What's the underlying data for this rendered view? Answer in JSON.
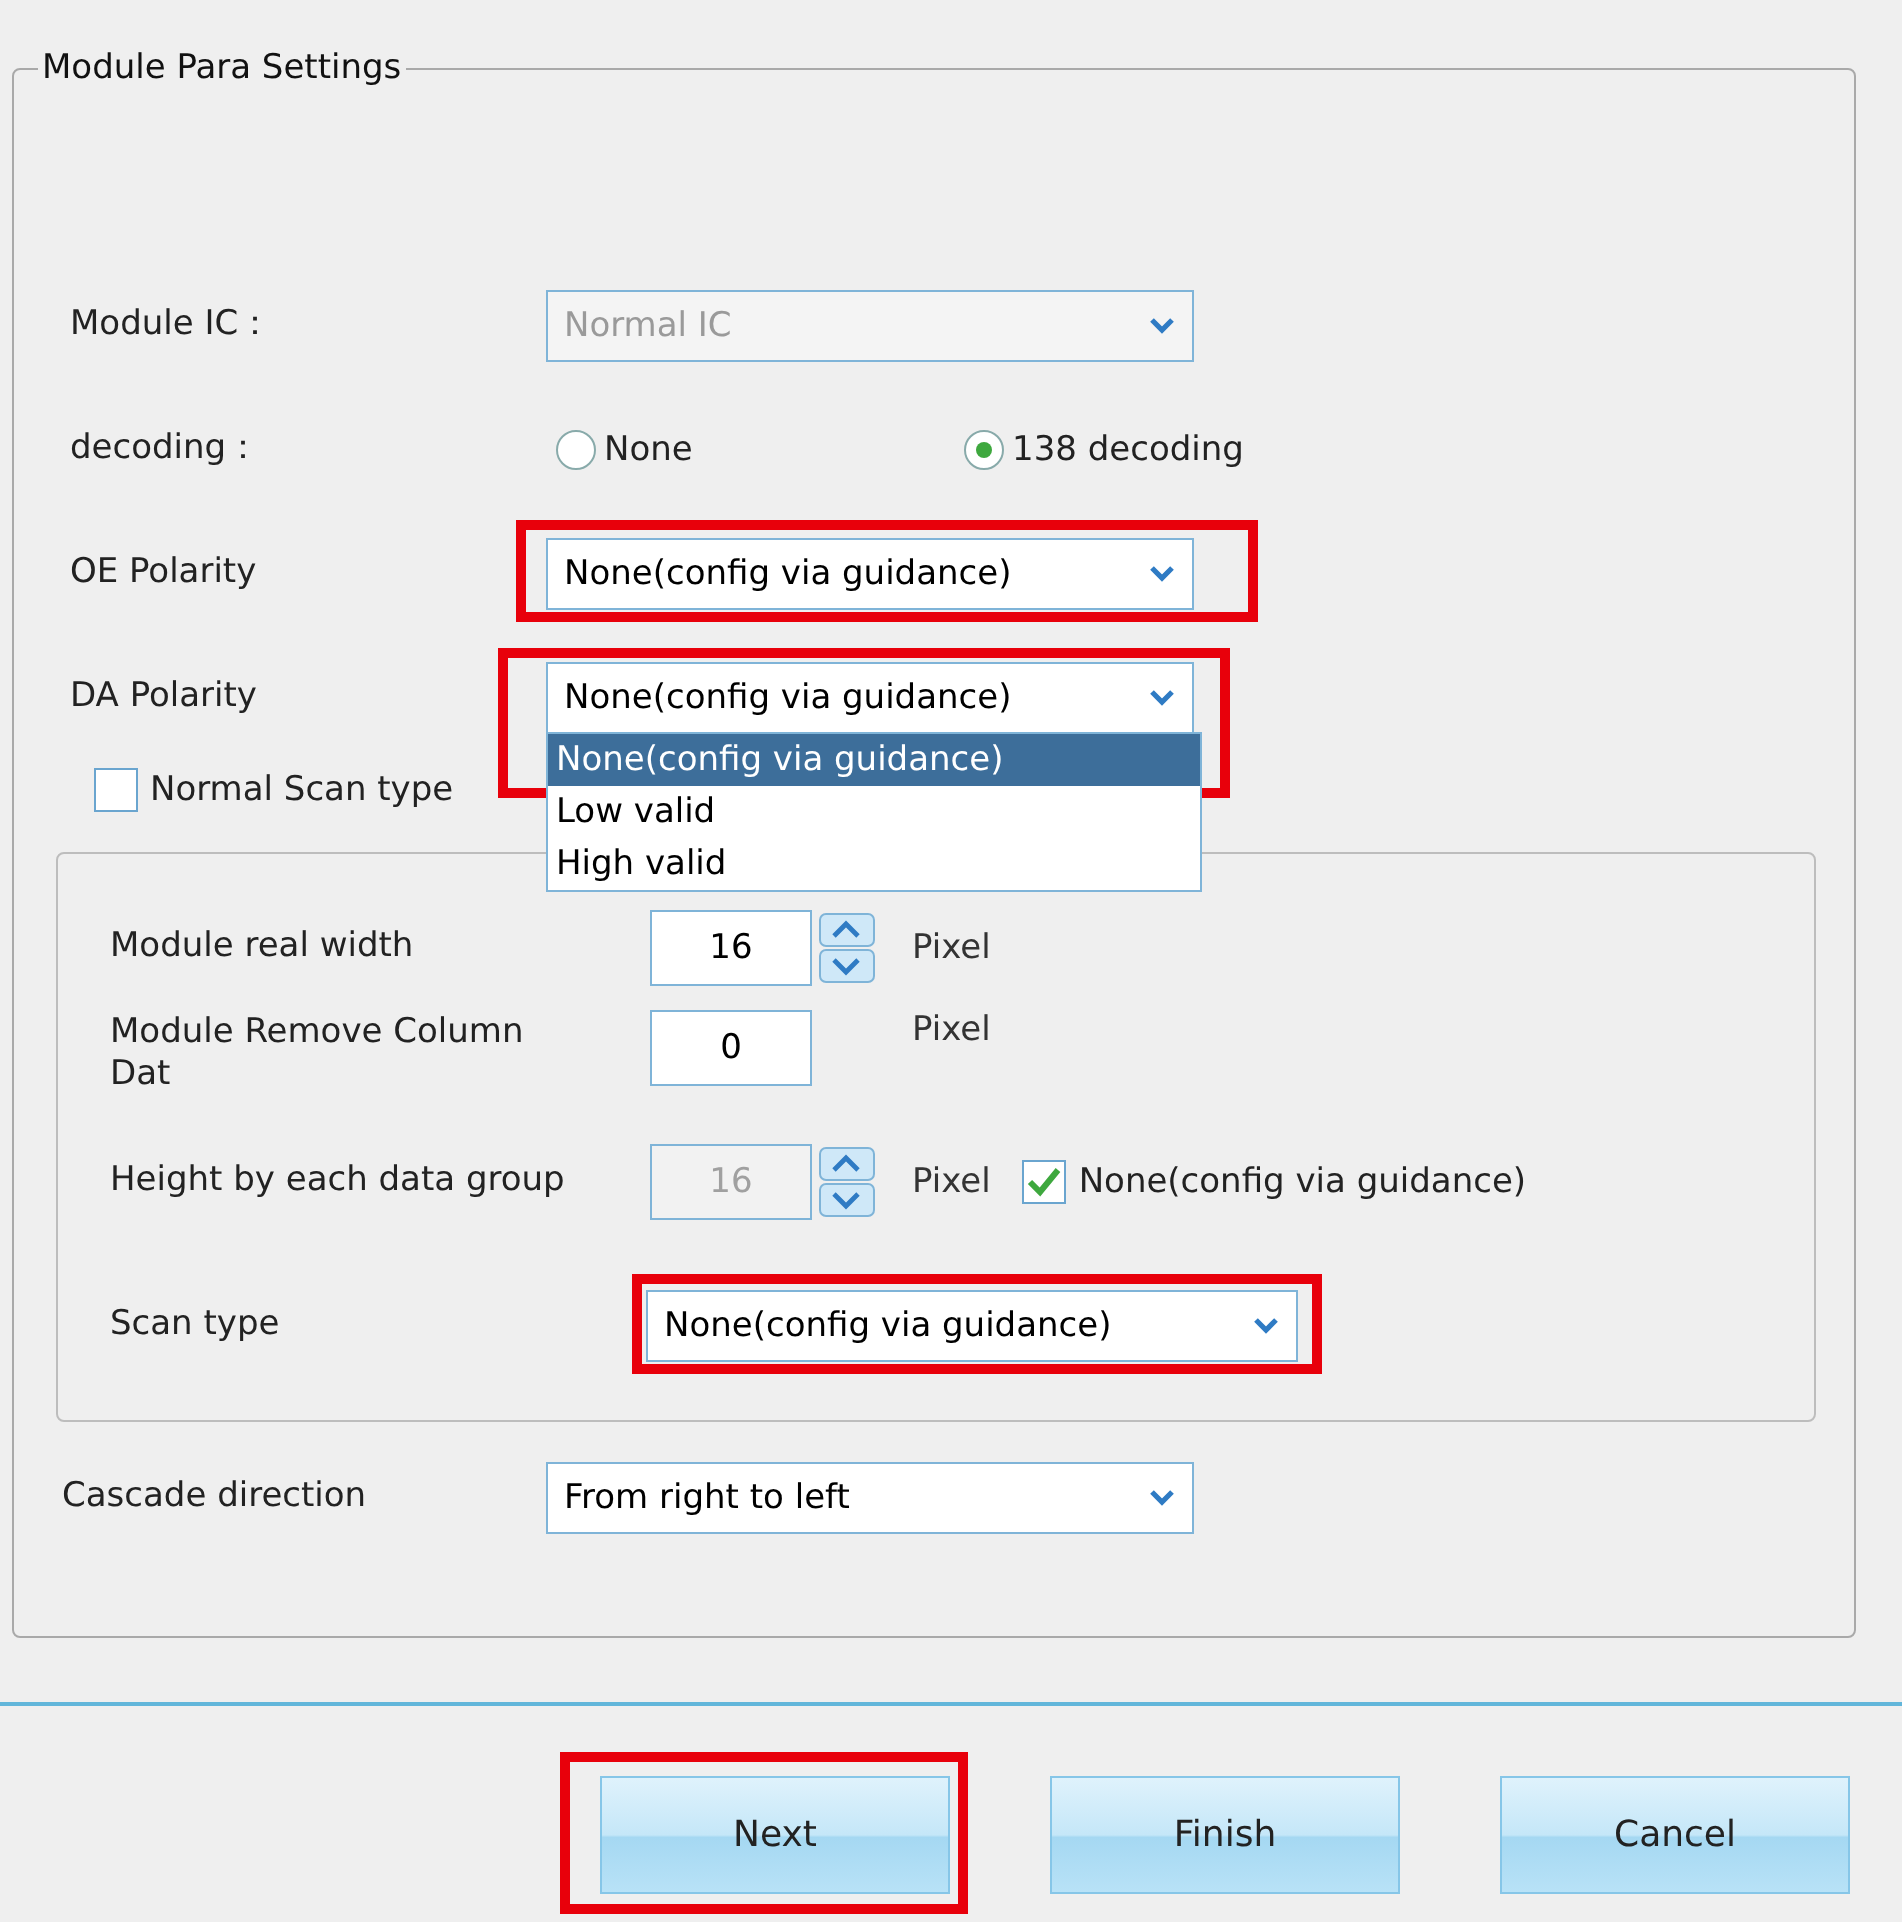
{
  "group_title": "Module Para Settings",
  "fields": [
    {
      "kind": "combo",
      "label": "Module IC：",
      "value": "Normal IC",
      "disabled": true,
      "highlighted": false,
      "expanded": false
    },
    {
      "kind": "radio",
      "label": "decoding：",
      "options": [
        {
          "label": "None",
          "selected": false
        },
        {
          "label": "138 decoding",
          "selected": true
        }
      ]
    },
    {
      "kind": "combo",
      "label": "OE Polarity",
      "value": "None(config via guidance)",
      "disabled": false,
      "highlighted": true,
      "expanded": false
    },
    {
      "kind": "combo",
      "label": "DA Polarity",
      "value": "None(config via guidance)",
      "disabled": false,
      "highlighted": true,
      "expanded": true,
      "options": [
        {
          "label": "None(config via guidance)",
          "selected": true
        },
        {
          "label": "Low valid",
          "selected": false
        },
        {
          "label": "High valid",
          "selected": false
        }
      ]
    }
  ],
  "normal_scan": {
    "label": "Normal Scan type",
    "checked": false
  },
  "inner_rows": [
    {
      "kind": "spin",
      "label": "Module real width",
      "value": "16",
      "disabled": false,
      "unit": "Pixel"
    },
    {
      "kind": "number",
      "label": "Module Remove Column Dat",
      "value": "0",
      "unit": "Pixel"
    },
    {
      "kind": "spin",
      "label": "Height by each data group",
      "value": "16",
      "disabled": true,
      "unit": "Pixel",
      "checkbox": {
        "label": "None(config via guidance)",
        "checked": true
      }
    },
    {
      "kind": "combo",
      "label": "Scan type",
      "value": "None(config via guidance)",
      "highlighted": true
    }
  ],
  "cascade": {
    "label": "Cascade direction",
    "value": "From right to left",
    "highlighted": false
  },
  "buttons": [
    {
      "label": "Next",
      "highlighted": true
    },
    {
      "label": "Finish",
      "highlighted": false
    },
    {
      "label": "Cancel",
      "highlighted": false
    }
  ]
}
